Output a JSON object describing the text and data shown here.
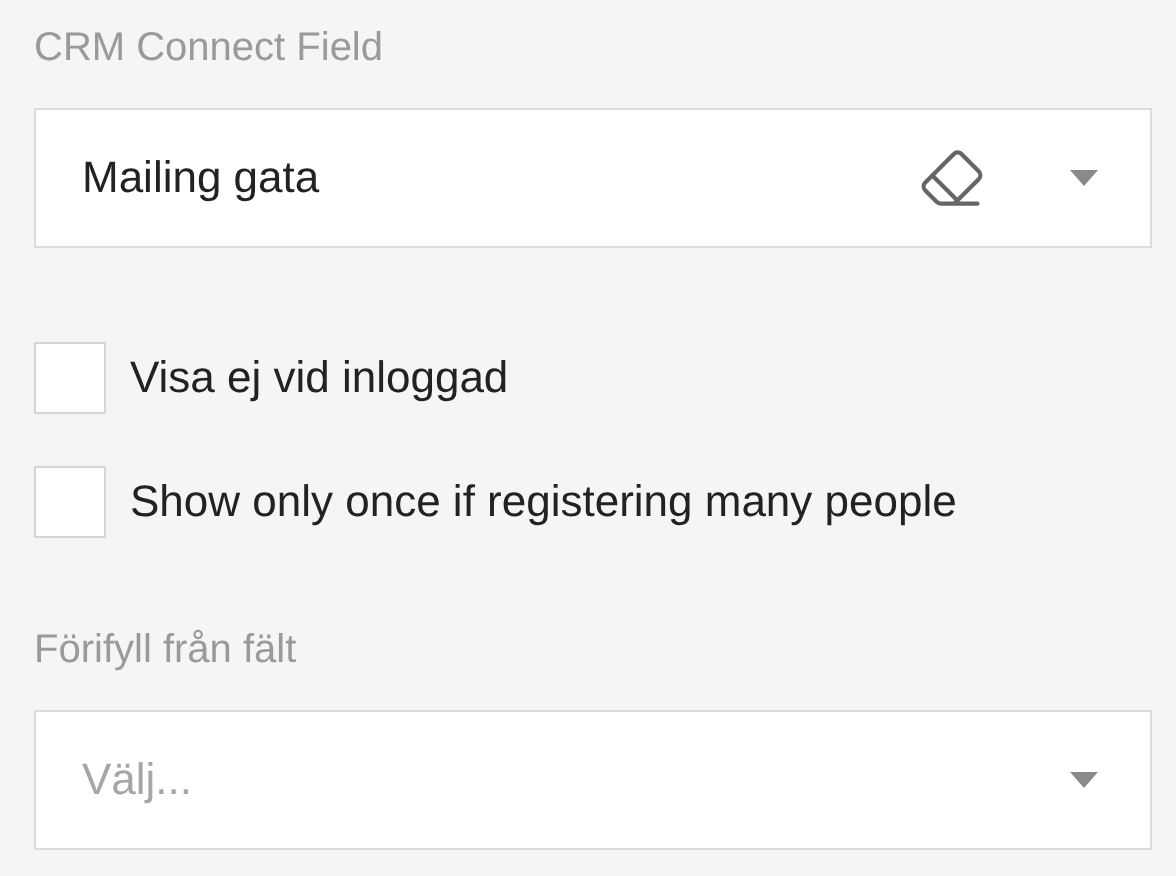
{
  "crm_field": {
    "label": "CRM Connect Field",
    "value": "Mailing gata"
  },
  "checkboxes": [
    {
      "label": "Visa ej vid inloggad",
      "checked": false
    },
    {
      "label": "Show only once if registering many people",
      "checked": false
    }
  ],
  "prefill_field": {
    "label": "Förifyll från fält",
    "placeholder": "Välj..."
  }
}
